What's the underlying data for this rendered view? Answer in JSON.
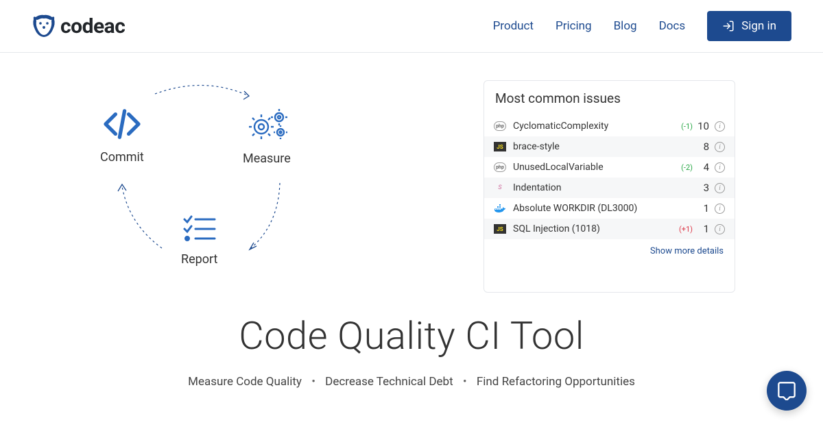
{
  "brand": {
    "name": "codeac"
  },
  "nav": {
    "items": [
      {
        "label": "Product"
      },
      {
        "label": "Pricing"
      },
      {
        "label": "Blog"
      },
      {
        "label": "Docs"
      }
    ],
    "signin": "Sign in"
  },
  "cycle": {
    "commit": "Commit",
    "measure": "Measure",
    "report": "Report"
  },
  "issues": {
    "title": "Most common issues",
    "rows": [
      {
        "lang": "php",
        "name": "CyclomaticComplexity",
        "delta": "(-1)",
        "delta_sign": "neg",
        "count": "10"
      },
      {
        "lang": "js",
        "name": "brace-style",
        "delta": "",
        "delta_sign": "",
        "count": "8"
      },
      {
        "lang": "php",
        "name": "UnusedLocalVariable",
        "delta": "(-2)",
        "delta_sign": "neg",
        "count": "4"
      },
      {
        "lang": "sass",
        "name": "Indentation",
        "delta": "",
        "delta_sign": "",
        "count": "3"
      },
      {
        "lang": "docker",
        "name": "Absolute WORKDIR (DL3000)",
        "delta": "",
        "delta_sign": "",
        "count": "1"
      },
      {
        "lang": "js",
        "name": "SQL Injection (1018)",
        "delta": "(+1)",
        "delta_sign": "pos",
        "count": "1"
      }
    ],
    "show_more": "Show more details"
  },
  "headline": "Code Quality CI Tool",
  "subhead": {
    "a": "Measure Code Quality",
    "b": "Decrease Technical Debt",
    "c": "Find Refactoring Opportunities"
  }
}
